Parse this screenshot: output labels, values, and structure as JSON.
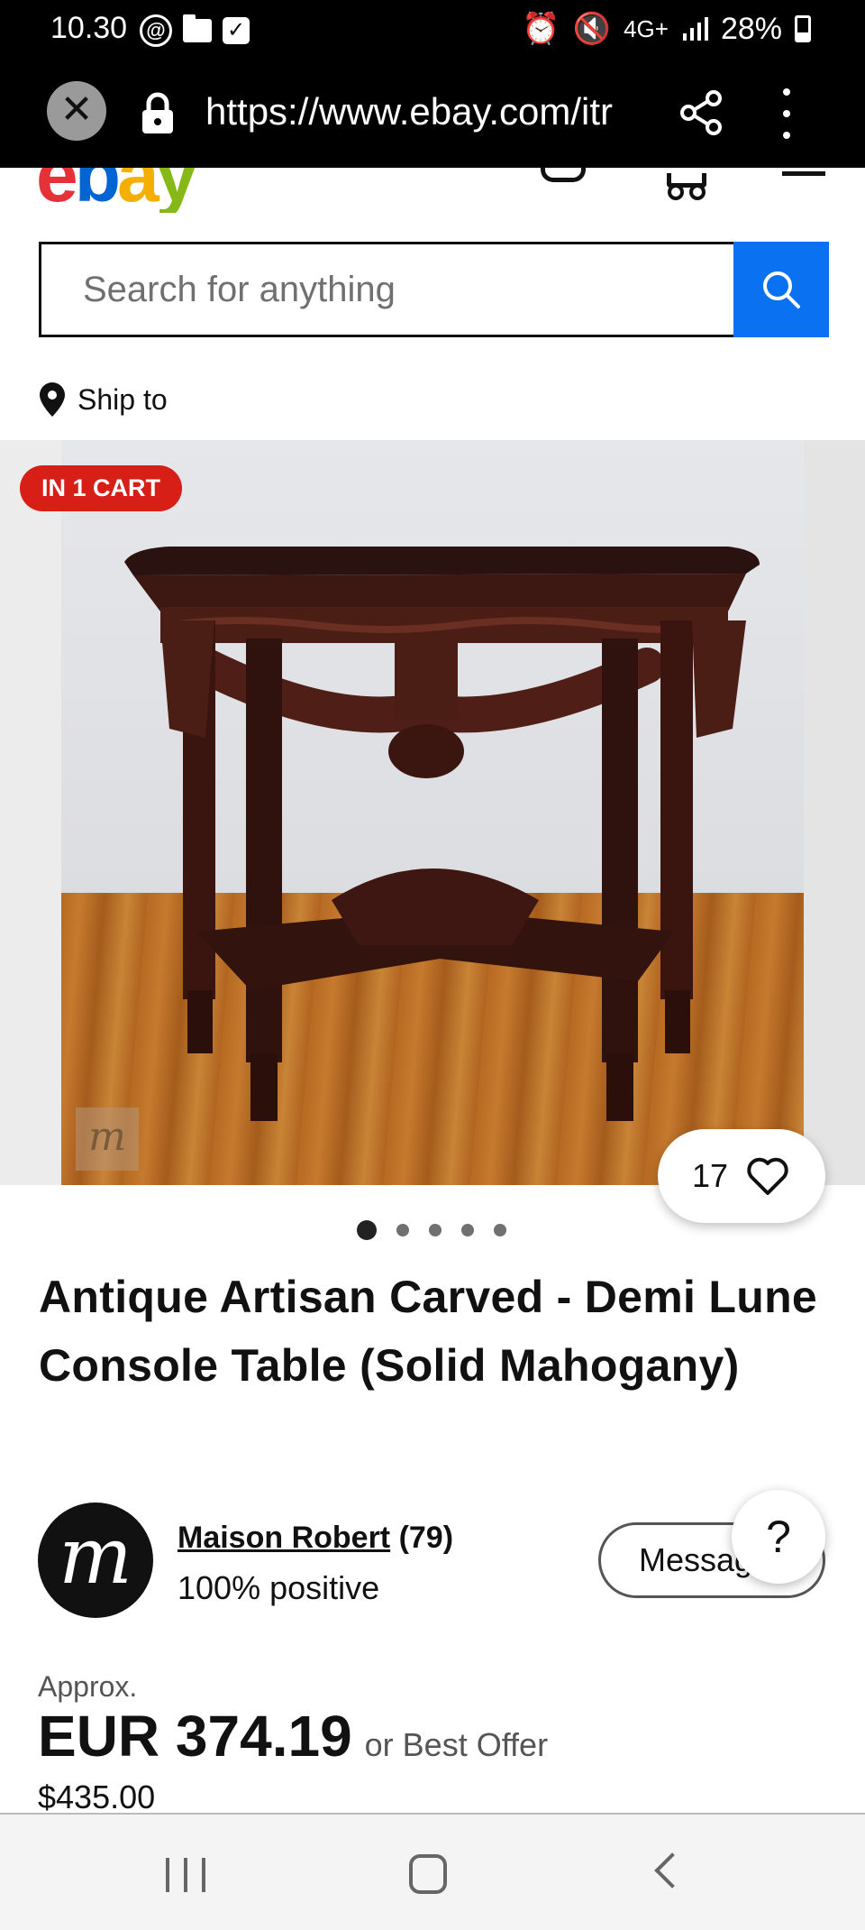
{
  "status_bar": {
    "time": "10.30",
    "network": "4G+",
    "battery": "28%",
    "icons": [
      "at-sign-icon",
      "folder-icon",
      "checkbox-icon",
      "alarm-icon",
      "mute-icon",
      "signal-icon",
      "battery-icon"
    ]
  },
  "browser": {
    "url": "https://www.ebay.com/itr",
    "icons": [
      "close-icon",
      "lock-icon",
      "share-icon",
      "more-icon"
    ]
  },
  "header": {
    "logo_letters": [
      "e",
      "b",
      "a",
      "y"
    ],
    "brand_colors": {
      "e": "#e53238",
      "b": "#0064d2",
      "a": "#f5af02",
      "y": "#86b817"
    }
  },
  "search": {
    "placeholder": "Search for anything",
    "button_color": "#0a72f0"
  },
  "ship_to": {
    "label": "Ship to"
  },
  "gallery": {
    "badge": "IN 1 CART",
    "badge_color": "#d71e17",
    "watch_count": "17",
    "image_count": 5,
    "active_index": 0
  },
  "item": {
    "title": "Antique Artisan Carved - Demi Lune Console Table (Solid Mahogany)"
  },
  "seller": {
    "name": "Maison Robert",
    "feedback_count": "(79)",
    "positive": "100% positive",
    "message_label": "Message",
    "help_label": "?"
  },
  "price": {
    "approx_label": "Approx.",
    "amount": "EUR 374.19",
    "best_offer": "or Best Offer",
    "original": "$435.00"
  }
}
